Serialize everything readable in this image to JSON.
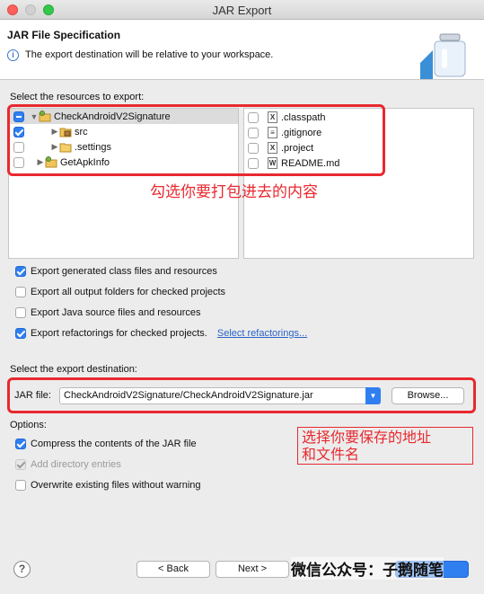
{
  "window": {
    "title": "JAR Export"
  },
  "header": {
    "title": "JAR File Specification",
    "message": "The export destination will be relative to your workspace."
  },
  "resources": {
    "label": "Select the resources to export:",
    "tree": [
      {
        "name": "CheckAndroidV2Signature",
        "state": "mixed",
        "expanded": true,
        "selected": true
      },
      {
        "name": "src",
        "state": "checked",
        "expanded": false
      },
      {
        "name": ".settings",
        "state": "unchecked",
        "expanded": false
      },
      {
        "name": "GetApkInfo",
        "state": "unchecked",
        "expanded": false
      }
    ],
    "files": [
      {
        "name": ".classpath",
        "icon": "X"
      },
      {
        "name": ".gitignore",
        "icon": ""
      },
      {
        "name": ".project",
        "icon": "X"
      },
      {
        "name": "README.md",
        "icon": "W"
      }
    ]
  },
  "options_export": [
    {
      "label": "Export generated class files and resources",
      "checked": true
    },
    {
      "label": "Export all output folders for checked projects",
      "checked": false
    },
    {
      "label": "Export Java source files and resources",
      "checked": false
    },
    {
      "label": "Export refactorings for checked projects.",
      "checked": true,
      "link": "Select refactorings..."
    }
  ],
  "destination": {
    "label": "Select the export destination:",
    "jar_label": "JAR file:",
    "jar_value": "CheckAndroidV2Signature/CheckAndroidV2Signature.jar",
    "browse_label": "Browse..."
  },
  "options": {
    "label": "Options:",
    "items": [
      {
        "label": "Compress the contents of the JAR file",
        "checked": true,
        "disabled": false
      },
      {
        "label": "Add directory entries",
        "checked": true,
        "disabled": true
      },
      {
        "label": "Overwrite existing files without warning",
        "checked": false,
        "disabled": false
      }
    ]
  },
  "annotations": {
    "resources_note": "勾选你要打包进去的内容",
    "destination_note_line1": "选择你要保存的地址",
    "destination_note_line2": "和文件名",
    "watermark": "微信公众号：子鹅随笔"
  },
  "footer": {
    "back_label": "< Back",
    "next_label": "Next >"
  },
  "colors": {
    "accent": "#2f7ff0",
    "annotation": "#e8292f",
    "link": "#2a63c7"
  }
}
